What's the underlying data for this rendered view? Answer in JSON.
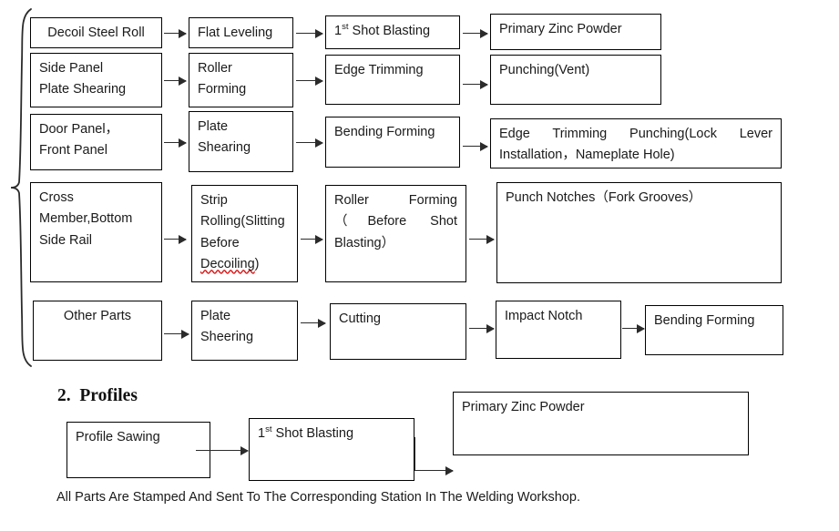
{
  "document": {
    "section2_heading": "2.  Profiles",
    "footnote": "All Parts Are Stamped And Sent To The Corresponding Station In The Welding Workshop."
  },
  "flow_parts": {
    "rows": [
      {
        "id": "row-decoil-steel-roll",
        "nodes": [
          {
            "id": "decoil-steel-roll",
            "label": "Decoil Steel Roll"
          },
          {
            "id": "flat-leveling",
            "label": "Flat Leveling"
          },
          {
            "id": "first-shot-blasting",
            "label": "1st Shot Blasting",
            "ordinal": "st",
            "base": "1",
            "rest": " Shot Blasting"
          },
          {
            "id": "primary-zinc-powder",
            "label": "Primary Zinc Powder"
          }
        ]
      },
      {
        "id": "row-side-panel",
        "nodes": [
          {
            "id": "side-panel-plate-shearing",
            "label": "Side Panel\nPlate Shearing"
          },
          {
            "id": "roller-forming",
            "label": "Roller\nForming"
          },
          {
            "id": "edge-trimming",
            "label": "Edge Trimming"
          },
          {
            "id": "punching-vent",
            "label": "Punching(Vent)"
          }
        ]
      },
      {
        "id": "row-door-panel",
        "nodes": [
          {
            "id": "door-panel-front-panel",
            "label": "Door Panel，\nFront Panel"
          },
          {
            "id": "plate-shearing",
            "label": "Plate\nShearing"
          },
          {
            "id": "bending-forming",
            "label": "Bending Forming"
          },
          {
            "id": "edge-trimming-punching-lock-lever",
            "label": "Edge Trimming Punching(Lock Lever Installation，Nameplate Hole)"
          }
        ]
      },
      {
        "id": "row-cross-member",
        "nodes": [
          {
            "id": "cross-member-bottom-side-rail",
            "label": "Cross\nMember,Bottom\nSide Rail"
          },
          {
            "id": "strip-rolling-slitting",
            "label": "Strip Rolling(Slitting Before Decoiling)",
            "misspelled_word": "Decoiling"
          },
          {
            "id": "roller-forming-before-shot-blasting",
            "label": "Roller Forming（Before Shot Blasting）"
          },
          {
            "id": "punch-notches-fork-grooves",
            "label": "Punch Notches（Fork Grooves）"
          }
        ]
      },
      {
        "id": "row-other-parts",
        "nodes": [
          {
            "id": "other-parts",
            "label": "Other Parts"
          },
          {
            "id": "plate-sheering",
            "label": "Plate\nSheering"
          },
          {
            "id": "cutting",
            "label": "Cutting"
          },
          {
            "id": "impact-notch",
            "label": "Impact Notch"
          },
          {
            "id": "bending-forming-2",
            "label": "Bending Forming"
          }
        ]
      }
    ]
  },
  "flow_profiles": {
    "nodes": [
      {
        "id": "profile-sawing",
        "label": "Profile Sawing"
      },
      {
        "id": "first-shot-blasting-profiles",
        "base": "1",
        "ordinal": "st",
        "rest": " Shot Blasting",
        "label": "1st Shot Blasting"
      },
      {
        "id": "primary-zinc-powder-profiles",
        "label": "Primary Zinc Powder"
      }
    ]
  },
  "colors": {
    "stroke": "#000000",
    "connector": "#2b2b2b",
    "text": "#1a1a1a",
    "background": "#ffffff",
    "spellcheck_underline": "#d81a1a"
  }
}
